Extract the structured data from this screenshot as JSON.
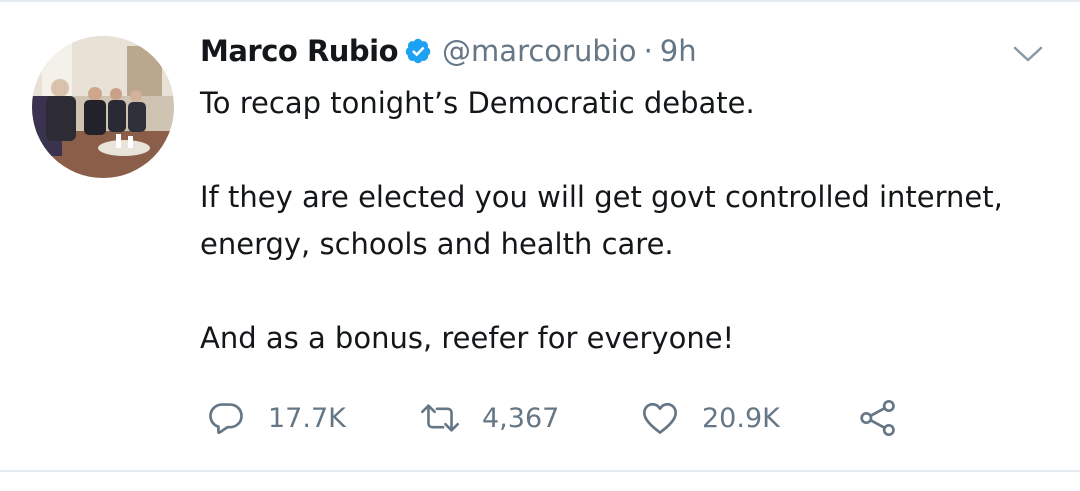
{
  "tweet": {
    "author": {
      "display_name": "Marco Rubio",
      "handle": "@marcorubio",
      "verified": true,
      "avatar_icon": "avatar-photo"
    },
    "separator": "·",
    "time": "9h",
    "text": {
      "line1": "To recap tonight’s Democratic debate.",
      "line2a": "If they are elected you will get govt controlled internet,",
      "line2b": "energy, schools and health care.",
      "line3": "And as a bonus, reefer for everyone!"
    },
    "actions": {
      "reply_count": "17.7K",
      "retweet_count": "4,367",
      "like_count": "20.9K"
    },
    "icons": {
      "verified": "verified-badge-icon",
      "menu": "chevron-down-icon",
      "reply": "reply-icon",
      "retweet": "retweet-icon",
      "like": "heart-icon",
      "share": "share-icon"
    },
    "colors": {
      "verified_blue": "#1da1f2",
      "secondary_text": "#657786",
      "primary_text": "#14171a"
    }
  }
}
